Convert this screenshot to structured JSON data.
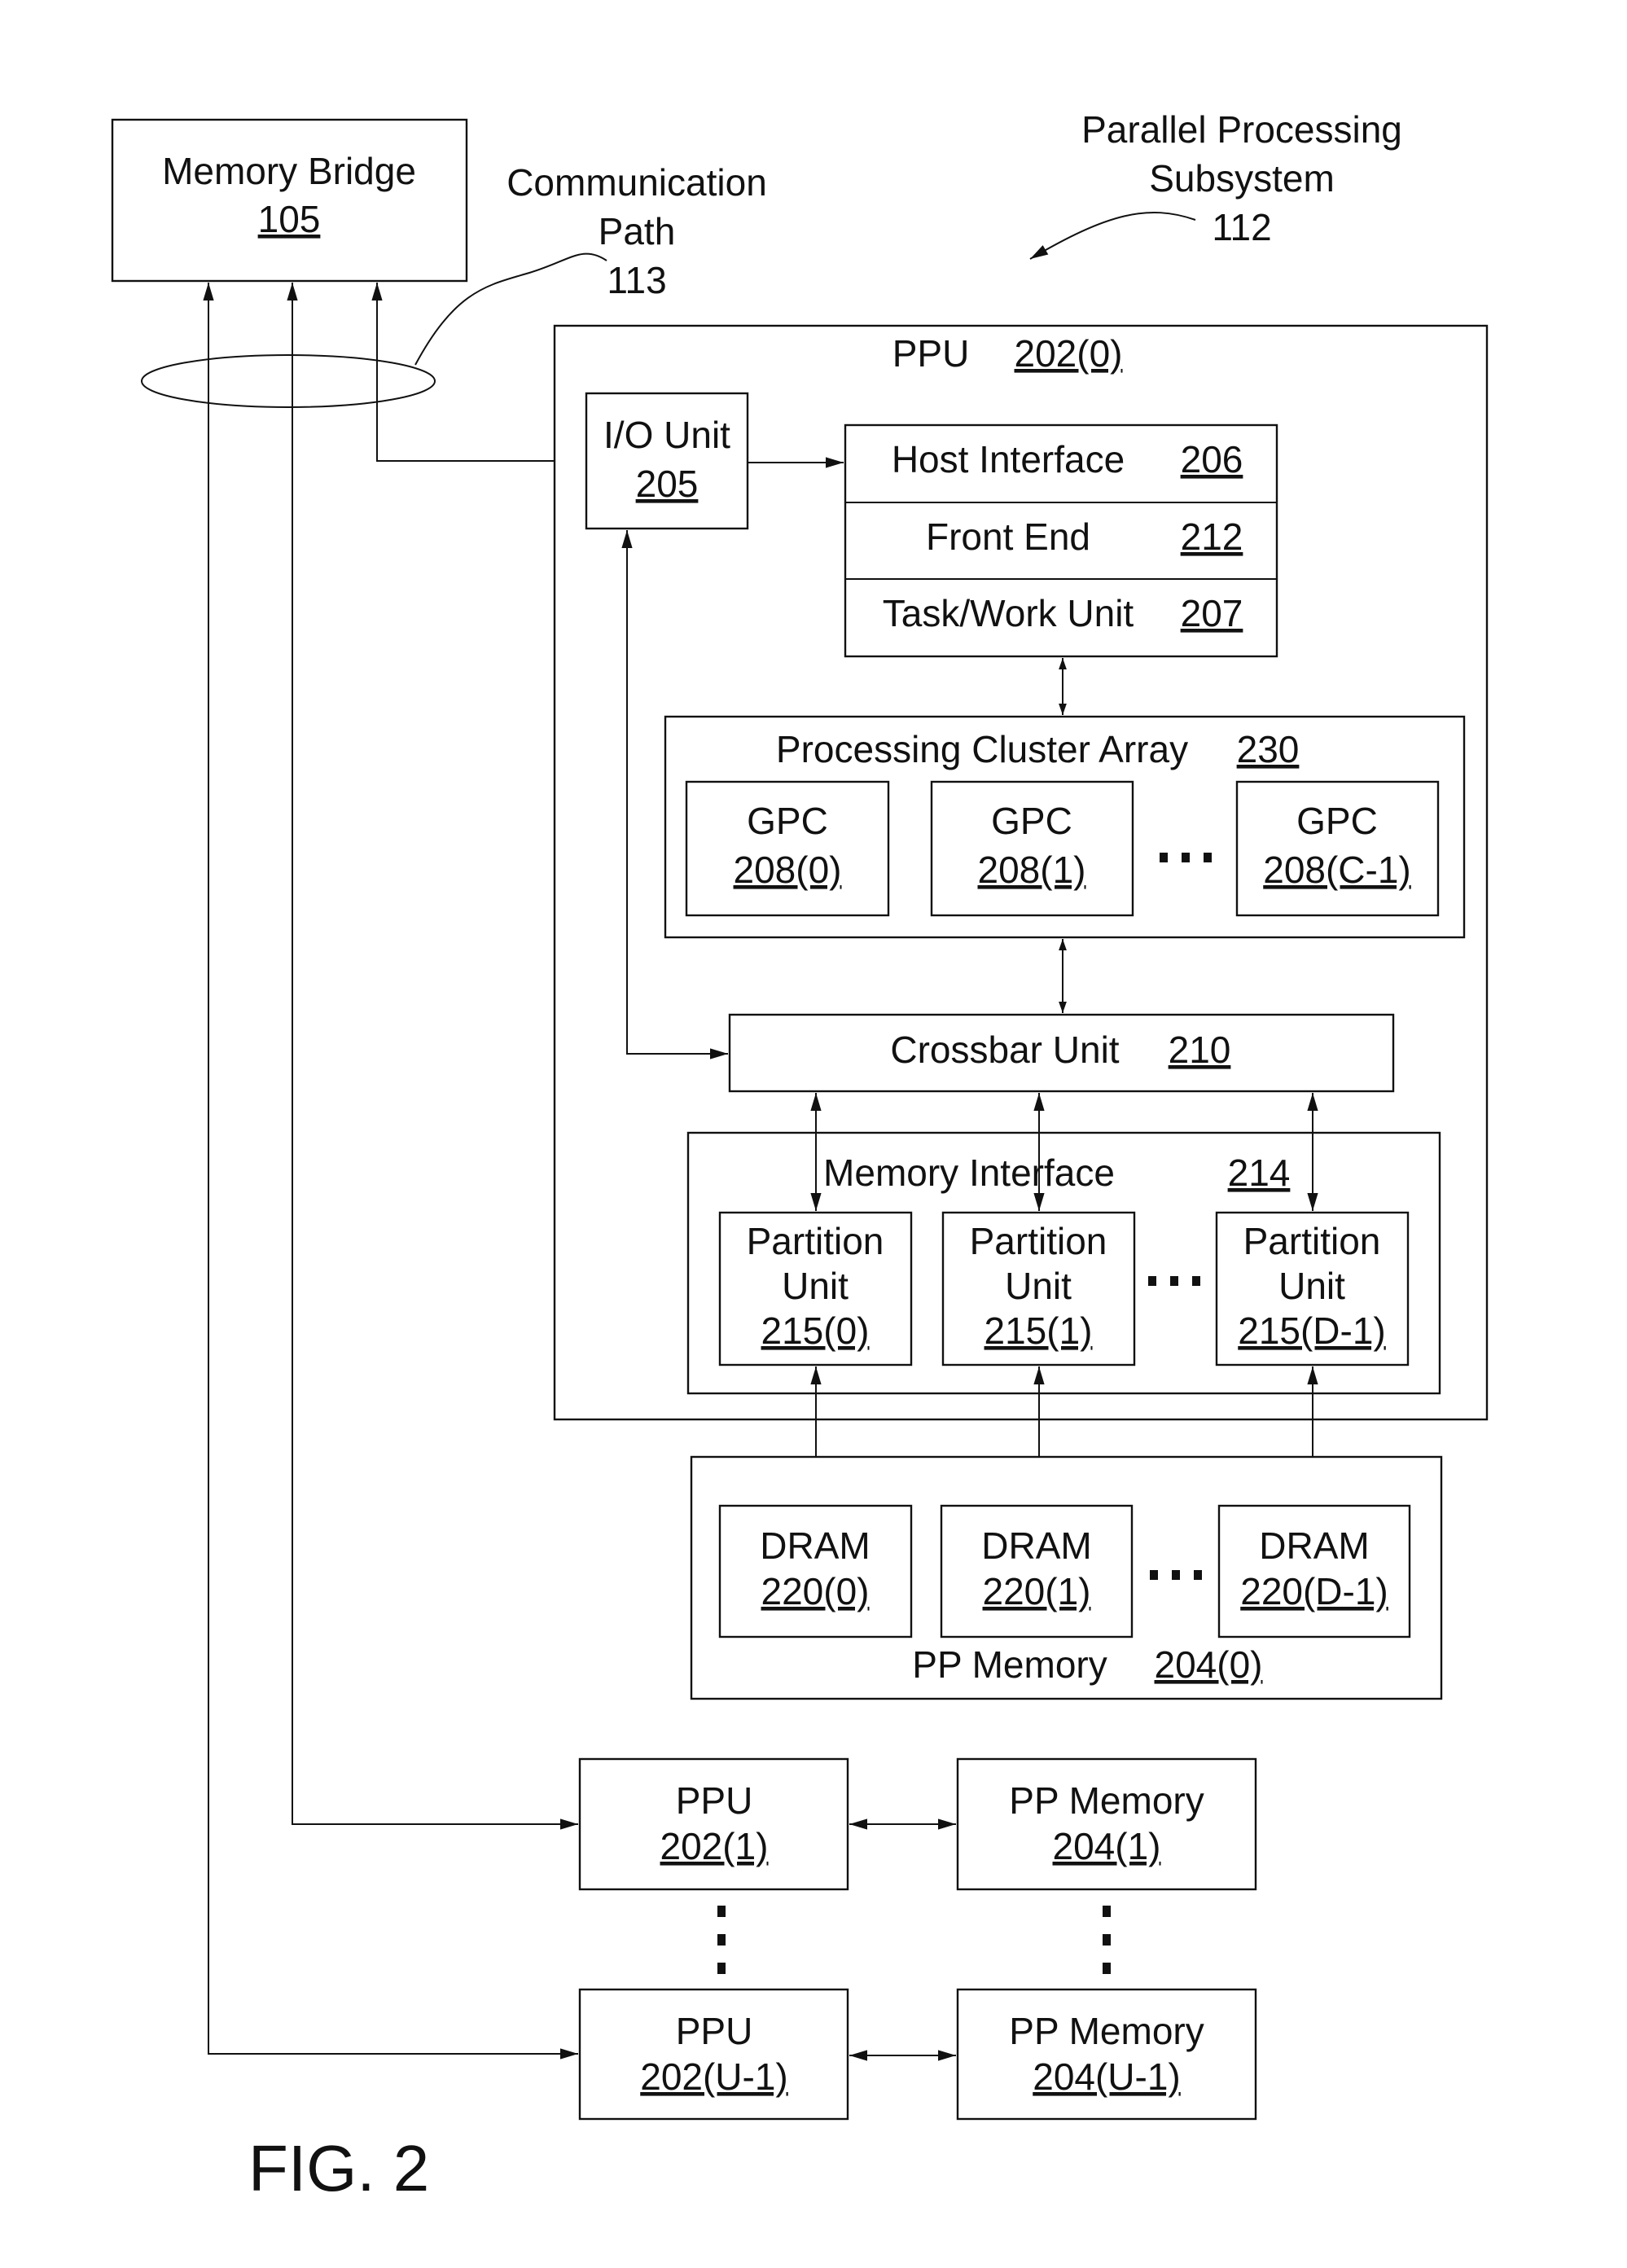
{
  "figure_label": "FIG. 2",
  "memory_bridge": {
    "name": "Memory Bridge",
    "ref": "105"
  },
  "communication_path": {
    "line1": "Communication",
    "line2": "Path",
    "ref": "113"
  },
  "subsystem": {
    "line1": "Parallel Processing",
    "line2": "Subsystem",
    "ref": "112"
  },
  "ppu0": {
    "name": "PPU",
    "ref": "202(0)",
    "io_unit": {
      "name": "I/O Unit",
      "ref": "205"
    },
    "host_stack": [
      {
        "name": "Host Interface",
        "ref": "206"
      },
      {
        "name": "Front End",
        "ref": "212"
      },
      {
        "name": "Task/Work Unit",
        "ref": "207"
      }
    ],
    "processing_cluster_array": {
      "name": "Processing Cluster Array",
      "ref": "230",
      "gpcs": [
        {
          "name": "GPC",
          "ref": "208(0)"
        },
        {
          "name": "GPC",
          "ref": "208(1)"
        },
        {
          "name": "GPC",
          "ref": "208(C-1)"
        }
      ]
    },
    "crossbar": {
      "name": "Crossbar Unit",
      "ref": "210"
    },
    "memory_interface": {
      "name": "Memory Interface",
      "ref": "214",
      "partition_units": [
        {
          "line1": "Partition",
          "line2": "Unit",
          "ref": "215(0)"
        },
        {
          "line1": "Partition",
          "line2": "Unit",
          "ref": "215(1)"
        },
        {
          "line1": "Partition",
          "line2": "Unit",
          "ref": "215(D-1)"
        }
      ]
    }
  },
  "pp_memory0": {
    "name": "PP Memory",
    "ref": "204(0)",
    "drams": [
      {
        "name": "DRAM",
        "ref": "220(0)"
      },
      {
        "name": "DRAM",
        "ref": "220(1)"
      },
      {
        "name": "DRAM",
        "ref": "220(D-1)"
      }
    ]
  },
  "additional_ppus": [
    {
      "ppu": {
        "name": "PPU",
        "ref": "202(1)"
      },
      "memory": {
        "name": "PP Memory",
        "ref": "204(1)"
      }
    },
    {
      "ppu": {
        "name": "PPU",
        "ref": "202(U-1)"
      },
      "memory": {
        "name": "PP Memory",
        "ref": "204(U-1)"
      }
    }
  ]
}
